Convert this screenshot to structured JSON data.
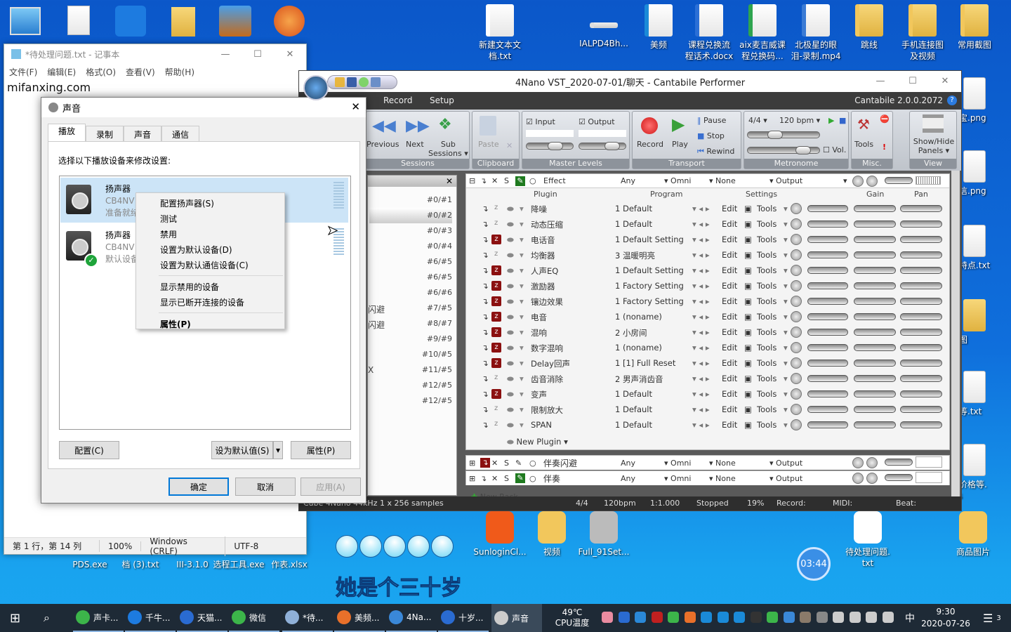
{
  "desktop": {
    "top_icons": [
      {
        "label": "新建文本文\n档.txt",
        "kind": "file",
        "color": "#ffffff"
      },
      {
        "label": "IALPD4Bh...",
        "kind": "image",
        "color": "#dddddd"
      },
      {
        "label": "美频",
        "kind": "app",
        "color": "#1b8ad8"
      },
      {
        "label": "课程兑换流\n程话术.docx",
        "kind": "word",
        "color": "#2b6fd6"
      },
      {
        "label": "aix麦吉威课\n程兑换码...",
        "kind": "sheet",
        "color": "#2ea44f"
      },
      {
        "label": "北极星的眼\n泪-录制.mp4",
        "kind": "video",
        "color": "#3a7bd5"
      },
      {
        "label": "跳线",
        "kind": "folder",
        "color": "#f2c75c"
      },
      {
        "label": "手机连接图\n及视频",
        "kind": "folder",
        "color": "#f2c75c"
      },
      {
        "label": "常用截图",
        "kind": "folder",
        "color": "#f2c75c"
      }
    ],
    "right_icons": [
      {
        "label": "付宝.png"
      },
      {
        "label": "微信.png"
      },
      {
        "label": "品特点.txt"
      },
      {
        "label": "截图"
      },
      {
        "label": "址等.txt"
      },
      {
        "label": "品价格等.\nxls"
      }
    ],
    "bottom_icons": [
      {
        "label": "SunloginCl...",
        "color": "#f05a1a"
      },
      {
        "label": "视频",
        "color": "#f2c75c"
      },
      {
        "label": "Full_91Set...",
        "color": "#bbbbbb"
      },
      {
        "label": "待处理问题.\ntxt",
        "color": "#ffffff"
      },
      {
        "label": "商品图片",
        "color": "#f2c75c"
      }
    ],
    "hidden_labels": [
      "PDS.exe",
      "档 (3).txt",
      "III-3.1.0",
      "选程工具.exe",
      "作表.xlsx"
    ],
    "overlay_text": "她是个三十岁",
    "timer": "03:44"
  },
  "notepad": {
    "title": "*待处理问题.txt - 记事本",
    "menu": [
      "文件(F)",
      "编辑(E)",
      "格式(O)",
      "查看(V)",
      "帮助(H)"
    ],
    "text": "mifanxing.com",
    "status": [
      "第 1 行，第 14 列",
      "100%",
      "Windows (CRLF)",
      "UTF-8"
    ]
  },
  "sound": {
    "title": "声音",
    "tabs": [
      "播放",
      "录制",
      "声音",
      "通信"
    ],
    "active_tab": "播放",
    "instruction": "选择以下播放设备来修改设置:",
    "devices": [
      {
        "name": "扬声器",
        "sub": "CB4NV",
        "state": "准备就绪",
        "selected": true,
        "default": false
      },
      {
        "name": "扬声器",
        "sub": "CB4NV",
        "state": "默认设备",
        "selected": false,
        "default": true
      }
    ],
    "buttons": {
      "configure": "配置(C)",
      "set_default": "设为默认值(S)",
      "properties": "属性(P)",
      "ok": "确定",
      "cancel": "取消",
      "apply": "应用(A)"
    }
  },
  "context_menu": {
    "items": [
      "配置扬声器(S)",
      "测试",
      "禁用",
      "设置为默认设备(D)",
      "设置为默认通信设备(C)"
    ],
    "items2": [
      "显示禁用的设备",
      "显示已断开连接的设备"
    ],
    "bold_item": "属性(P)"
  },
  "cantabile": {
    "title": "4Nano VST_2020-07-01/聊天 - Cantabile Performer",
    "version": "Cantabile 2.0.0.2072",
    "tabs": [
      "Record",
      "Setup"
    ],
    "ribbon": {
      "sessions": {
        "label": "Sessions",
        "previous": "Previous",
        "next": "Next",
        "sub": "Sub\nSessions ▾"
      },
      "clipboard": {
        "label": "Clipboard",
        "paste": "Paste"
      },
      "master": {
        "label": "Master Levels",
        "input": "Input",
        "output": "Output"
      },
      "transport": {
        "label": "Transport",
        "record": "Record",
        "play": "Play",
        "pause": "Pause",
        "stop": "Stop",
        "rewind": "Rewind"
      },
      "metronome": {
        "label": "Metronome",
        "timesig": "4/4",
        "bpm": "120 bpm",
        "vol": "Vol."
      },
      "misc": {
        "label": "Misc.",
        "tools": "Tools"
      },
      "view": {
        "label": "View",
        "showhide": "Show/Hide\nPanels ▾"
      }
    },
    "sessions": [
      "#0/#1",
      "#0/#2",
      "#0/#3",
      "#0/#4",
      "#6/#5",
      "#6/#5",
      "#6/#6",
      "#7/#5",
      "#8/#7",
      "#9/#9",
      "#10/#5",
      "#11/#5",
      "#12/#5",
      "#12/#5"
    ],
    "session_fragments": [
      "闪避",
      "闪避",
      "X"
    ],
    "effect_rack": {
      "name": "Effect",
      "midi": "Any",
      "channel": "Omni",
      "route": "None",
      "output": "Output"
    },
    "columns": {
      "plugin": "Plugin",
      "program": "Program",
      "settings": "Settings",
      "gain": "Gain",
      "pan": "Pan"
    },
    "plugins": [
      {
        "name": "降噪",
        "program": "1 Default",
        "bypass": false
      },
      {
        "name": "动态压缩",
        "program": "1 Default",
        "bypass": false
      },
      {
        "name": "电话音",
        "program": "1 Default Setting",
        "bypass": true
      },
      {
        "name": "均衡器",
        "program": "3 温暖明亮",
        "bypass": false
      },
      {
        "name": "人声EQ",
        "program": "1 Default Setting",
        "bypass": true
      },
      {
        "name": "激励器",
        "program": "1 Factory Setting",
        "bypass": true
      },
      {
        "name": "镶边效果",
        "program": "1 Factory Setting",
        "bypass": true
      },
      {
        "name": "电音",
        "program": "1 (noname)",
        "bypass": true
      },
      {
        "name": "混响",
        "program": "2 小房间",
        "bypass": true
      },
      {
        "name": "数字混响",
        "program": "1 (noname)",
        "bypass": true
      },
      {
        "name": "Delay回声",
        "program": "1 [1] Full Reset",
        "bypass": true
      },
      {
        "name": "齿音消除",
        "program": "2 男声消齿音",
        "bypass": false
      },
      {
        "name": "变声",
        "program": "1 Default",
        "bypass": true
      },
      {
        "name": "限制放大",
        "program": "1 Default",
        "bypass": false
      },
      {
        "name": "SPAN",
        "program": "1 Default",
        "bypass": false
      }
    ],
    "edit_label": "Edit",
    "tools_label": "Tools",
    "new_plugin": "New Plugin ▾",
    "racks": [
      {
        "name": "伴奏闪避",
        "midi": "Any",
        "channel": "Omni",
        "route": "None",
        "output": "Output",
        "bypass": true
      },
      {
        "name": "伴奏",
        "midi": "Any",
        "channel": "Omni",
        "route": "None",
        "output": "Output",
        "bypass": false
      }
    ],
    "new_rack": "New Rack",
    "status": {
      "device": "Cube 4Nano 44kHz 1 x 256 samples",
      "timesig": "4/4",
      "bpm": "120bpm",
      "position": "1:1.000",
      "state": "Stopped",
      "cpu": "19%",
      "record": "Record:",
      "midi": "MIDI:",
      "beat": "Beat:"
    }
  },
  "taskbar": {
    "apps": [
      "声卡...",
      "千牛...",
      "天猫...",
      "微信",
      "*待...",
      "美频...",
      "4Na...",
      "十岁...",
      "声音"
    ],
    "app_colors": [
      "#3cb54a",
      "#1d7be0",
      "#2a6bd1",
      "#3cb54a",
      "#8fb0d8",
      "#e8702a",
      "#3a88d8",
      "#2a6bd1",
      "#cccccc"
    ],
    "cpu_temp": "49℃",
    "cpu_label": "CPU温度",
    "ime": "中",
    "time": "9:30",
    "date": "2020-07-26",
    "notifications": "3"
  },
  "colors": {
    "bypass_red": "#8b1010",
    "selection": "#cce4f7",
    "accent": "#0078d7"
  }
}
